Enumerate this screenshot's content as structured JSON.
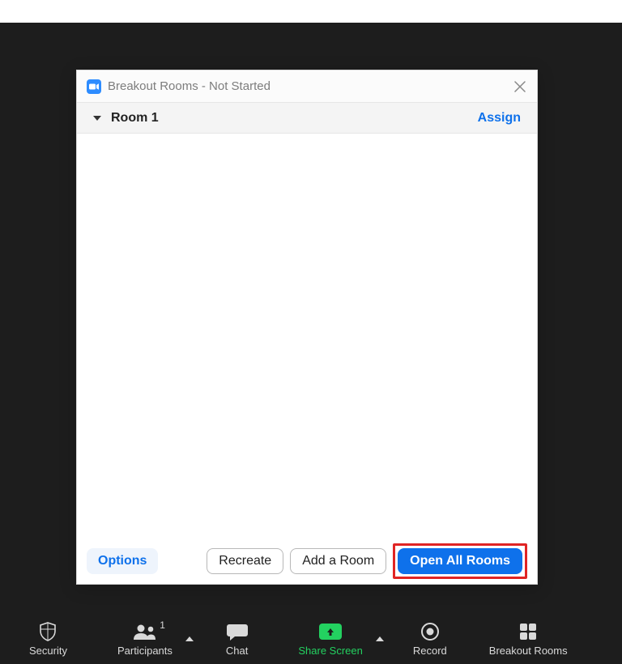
{
  "dialog": {
    "title": "Breakout Rooms - Not Started",
    "room_name": "Room 1",
    "assign_label": "Assign",
    "options_label": "Options",
    "recreate_label": "Recreate",
    "add_room_label": "Add a Room",
    "open_all_label": "Open All Rooms"
  },
  "toolbar": {
    "security": "Security",
    "participants": "Participants",
    "participants_count": "1",
    "chat": "Chat",
    "share_screen": "Share Screen",
    "record": "Record",
    "breakout_rooms": "Breakout Rooms"
  }
}
